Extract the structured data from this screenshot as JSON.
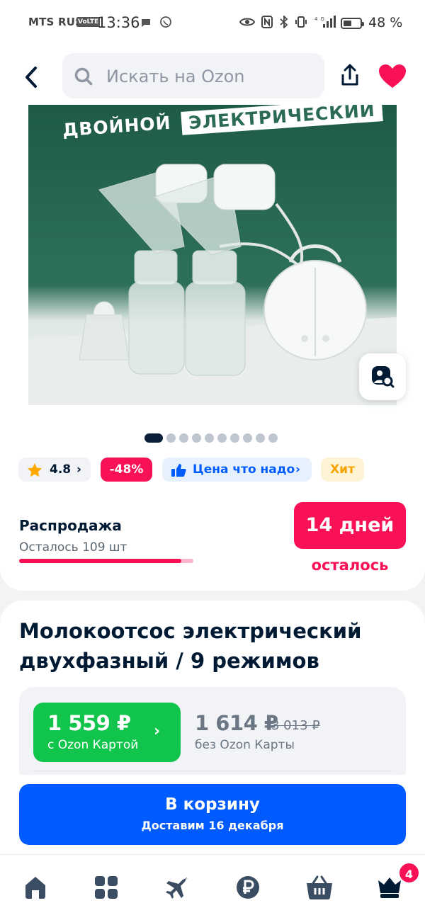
{
  "status_bar": {
    "carrier": "MTS RUS",
    "volte": "VoLTE",
    "time": "13:36",
    "battery_text": "48 %",
    "battery_level": 0.48,
    "icons": [
      "chat-icon",
      "viber-icon",
      "eye-icon",
      "nfc-icon",
      "bluetooth-icon",
      "vibrate-icon",
      "signal-4g-icon",
      "battery-icon"
    ]
  },
  "header": {
    "search_placeholder": "Искать на Ozon"
  },
  "gallery": {
    "banner_word_1": "ДВОЙНОЙ",
    "banner_word_2": "ЭЛЕКТРИЧЕСКИЙ",
    "dot_count": 10,
    "active_index": 0
  },
  "chips": {
    "rating": "4.8",
    "discount": "-48%",
    "price_tag": "Цена что надо",
    "hit": "Хит"
  },
  "sale": {
    "title": "Распродажа",
    "remaining": "Осталось 109 шт",
    "progress": 0.93,
    "days_value": "14 дней",
    "days_caption": "осталось"
  },
  "product": {
    "title": "Молокоотсос электрический двухфазный / 9 режимов"
  },
  "price": {
    "ozon_card_price": "1 559 ₽",
    "ozon_card_caption": "с Ozon Картой",
    "regular_price": "1 614 ₽",
    "old_price": "3 013 ₽",
    "regular_caption": "без Ozon Карты"
  },
  "cart": {
    "label": "В корзину",
    "delivery": "Доставим 16 декабря"
  },
  "tabbar": {
    "items": [
      "home-icon",
      "catalog-icon",
      "travel-icon",
      "finance-icon",
      "cart-icon",
      "profile-icon"
    ],
    "badge": "4"
  },
  "colors": {
    "brand_blue": "#005bff",
    "sale_pink": "#f91155",
    "card_green": "#10c44c",
    "hit_orange": "#f5a300"
  }
}
